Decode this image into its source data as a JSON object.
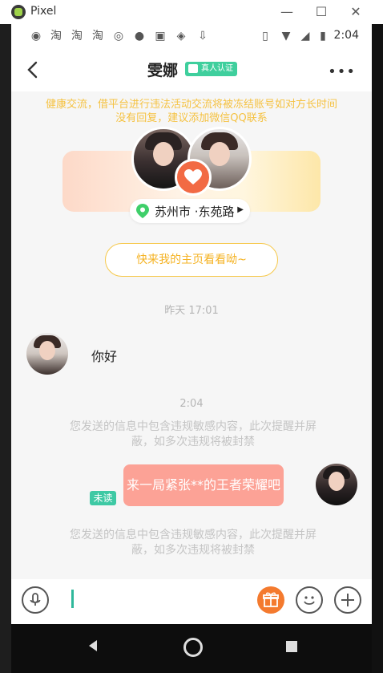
{
  "window": {
    "title": "Pixel",
    "minimize": "—",
    "maximize": "☐",
    "close": "✕"
  },
  "status_bar": {
    "time": "2:04"
  },
  "header": {
    "name": "雯娜",
    "verify_badge": "真人认证",
    "more": "•••"
  },
  "notice": "健康交流，借平台进行违法活动交流将被冻结账号如对方长时间没有回复，建议添加微信QQ联系",
  "banner": {
    "location": "苏州市 ·东苑路",
    "location_arrow": "▶"
  },
  "homepage_button": "快来我的主页看看呦~",
  "messages": {
    "timestamp_1": "昨天 17:01",
    "incoming_text": "你好",
    "timestamp_2": "2:04",
    "system_warning_1": "您发送的信息中包含违规敏感内容，此次提醒并屏蔽，如多次违规将被封禁",
    "outgoing_text": "来一局紧张**的王者荣耀吧",
    "unread_label": "未读",
    "system_warning_2": "您发送的信息中包含违规敏感内容，此次提醒并屏蔽，如多次违规将被封禁"
  },
  "colors": {
    "accent_yellow": "#f5c242",
    "bubble_out": "#fca296",
    "unread_green": "#3ec9a4",
    "gift_orange": "#f47a2e"
  }
}
